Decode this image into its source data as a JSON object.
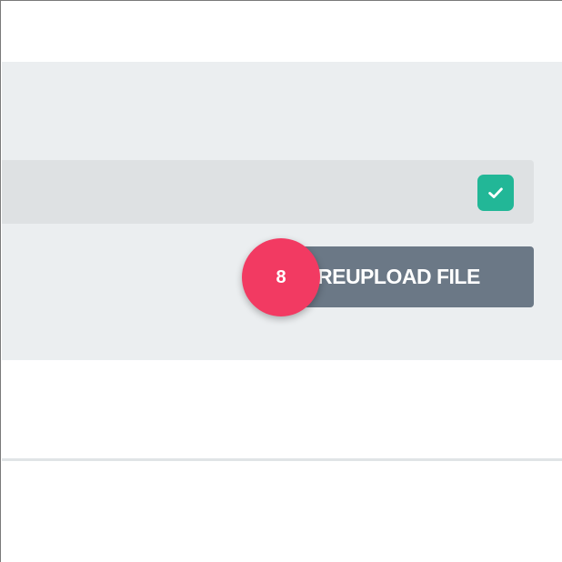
{
  "upload_panel": {
    "file_row": {
      "checkbox_checked": true,
      "check_icon": "check-icon",
      "checkbox_color": "#22b797"
    },
    "reupload_button": {
      "label": "REUPLOAD FILE",
      "color": "#6b7886"
    }
  },
  "step_badge": {
    "number": "8",
    "color": "#f23a62"
  }
}
